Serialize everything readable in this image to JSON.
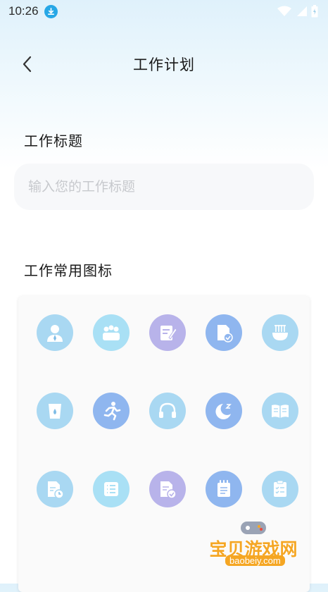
{
  "status_bar": {
    "time": "10:26"
  },
  "header": {
    "title": "工作计划",
    "back_icon": "chevron-left-icon"
  },
  "form": {
    "title_label": "工作标题",
    "title_placeholder": "输入您的工作标题",
    "title_value": "",
    "icons_label": "工作常用图标"
  },
  "icons": [
    {
      "name": "person-tie-icon",
      "color": "#a9d8f2"
    },
    {
      "name": "group-icon",
      "color": "#a9e0f5"
    },
    {
      "name": "edit-note-icon",
      "color": "#b8b3ea"
    },
    {
      "name": "document-check-icon",
      "color": "#8fb6ef"
    },
    {
      "name": "noodle-bowl-icon",
      "color": "#a9d8f2"
    },
    {
      "name": "water-cup-icon",
      "color": "#a9d8f2"
    },
    {
      "name": "running-icon",
      "color": "#8fb6ef"
    },
    {
      "name": "headphones-icon",
      "color": "#a9d8f2"
    },
    {
      "name": "sleep-moon-icon",
      "color": "#8fb6ef"
    },
    {
      "name": "open-book-icon",
      "color": "#a9d8f2"
    },
    {
      "name": "document-clock-icon",
      "color": "#a9d8f2"
    },
    {
      "name": "list-icon",
      "color": "#a9e0f5"
    },
    {
      "name": "document-approved-icon",
      "color": "#b8b3ea"
    },
    {
      "name": "notepad-icon",
      "color": "#8fb6ef"
    },
    {
      "name": "clipboard-checklist-icon",
      "color": "#a9d8f2"
    }
  ],
  "watermark": {
    "text": "宝贝游戏网",
    "url": "baobeiy.com"
  },
  "colors": {
    "accent": "#27a7e6",
    "input_bg": "#f7f8fa"
  }
}
